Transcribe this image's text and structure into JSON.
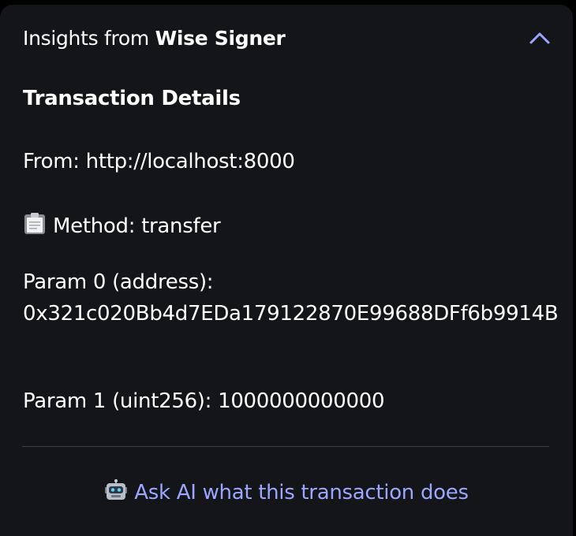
{
  "header": {
    "prefix": "Insights from",
    "brand": "Wise Signer",
    "toggle_icon": "chevron-up-icon"
  },
  "details": {
    "title": "Transaction Details",
    "from": "From: http://localhost:8000",
    "method_icon": "clipboard-icon",
    "method": "Method: transfer",
    "param0_label": "Param 0 (address):",
    "param0_value": "0x321c020Bb4d7EDa179122870E99688DFf6b9914B",
    "param1": "Param 1 (uint256): 1000000000000"
  },
  "ask_ai": {
    "icon": "robot-icon",
    "label": "Ask AI what this transaction does"
  },
  "colors": {
    "panel_bg": "#141518",
    "text": "#ffffff",
    "accent": "#9ca6ff",
    "divider": "#3a3c42"
  }
}
